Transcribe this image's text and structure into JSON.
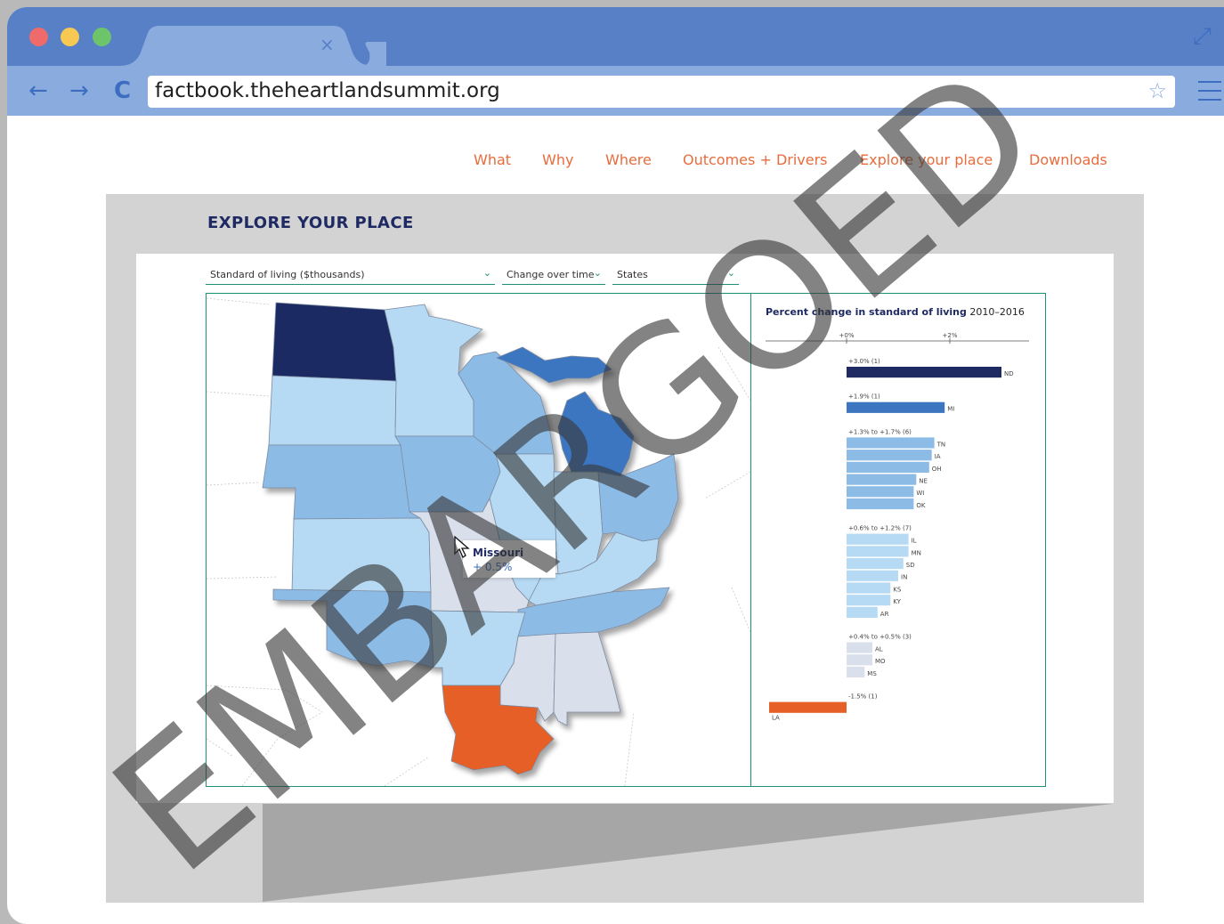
{
  "browser": {
    "url": "factbook.theheartlandsummit.org",
    "tab_close": "×",
    "back_glyph": "←",
    "forward_glyph": "→",
    "reload_glyph": "C",
    "star_glyph": "☆",
    "expand_glyph": "⤢",
    "traffic_colors": [
      "#ef6b6b",
      "#f8c952",
      "#6dc46b"
    ]
  },
  "site_nav": {
    "items": [
      "What",
      "Why",
      "Where",
      "Outcomes + Drivers",
      "Explore your place",
      "Downloads"
    ]
  },
  "page": {
    "heading": "EXPLORE YOUR PLACE"
  },
  "controls": {
    "metric": "Standard of living ($thousands)",
    "mode": "Change over time",
    "geography": "States"
  },
  "tooltip": {
    "state": "Missouri",
    "value": "+ 0.5%"
  },
  "watermark": "EMBARGOED",
  "colors": {
    "accent": "#e86c3c",
    "teal": "#1f8f76",
    "navy": "#1f2a63",
    "bucket_colors": [
      "#1f2a63",
      "#3d76c0",
      "#8cbbe6",
      "#b6daf4",
      "#d9e0ec",
      "#e65f26"
    ]
  },
  "chart_data": {
    "type": "bar",
    "title": "Percent change in standard of living",
    "title_years": "2010–2016",
    "axis_ticks": [
      {
        "value": 0,
        "label": "+0%"
      },
      {
        "value": 2,
        "label": "+2%"
      }
    ],
    "xlim": [
      -1.5,
      3.6
    ],
    "groups": [
      {
        "label": "+3.0% (1)",
        "color": "#1f2a63",
        "bars": [
          {
            "state": "ND",
            "value": 3.0
          }
        ]
      },
      {
        "label": "+1.9% (1)",
        "color": "#3d76c0",
        "bars": [
          {
            "state": "MI",
            "value": 1.9
          }
        ]
      },
      {
        "label": "+1.3% to +1.7% (6)",
        "color": "#8cbbe6",
        "bars": [
          {
            "state": "TN",
            "value": 1.7
          },
          {
            "state": "IA",
            "value": 1.65
          },
          {
            "state": "OH",
            "value": 1.6
          },
          {
            "state": "NE",
            "value": 1.35
          },
          {
            "state": "WI",
            "value": 1.3
          },
          {
            "state": "OK",
            "value": 1.3
          }
        ]
      },
      {
        "label": "+0.6% to +1.2% (7)",
        "color": "#b6daf4",
        "bars": [
          {
            "state": "IL",
            "value": 1.2
          },
          {
            "state": "MN",
            "value": 1.2
          },
          {
            "state": "SD",
            "value": 1.1
          },
          {
            "state": "IN",
            "value": 1.0
          },
          {
            "state": "KS",
            "value": 0.85
          },
          {
            "state": "KY",
            "value": 0.85
          },
          {
            "state": "AR",
            "value": 0.6
          }
        ]
      },
      {
        "label": "+0.4% to +0.5% (3)",
        "color": "#d9e0ec",
        "bars": [
          {
            "state": "AL",
            "value": 0.5
          },
          {
            "state": "MO",
            "value": 0.5
          },
          {
            "state": "MS",
            "value": 0.35
          }
        ]
      },
      {
        "label": "-1.5% (1)",
        "color": "#e65f26",
        "bars": [
          {
            "state": "LA",
            "value": -1.5
          }
        ]
      }
    ]
  }
}
